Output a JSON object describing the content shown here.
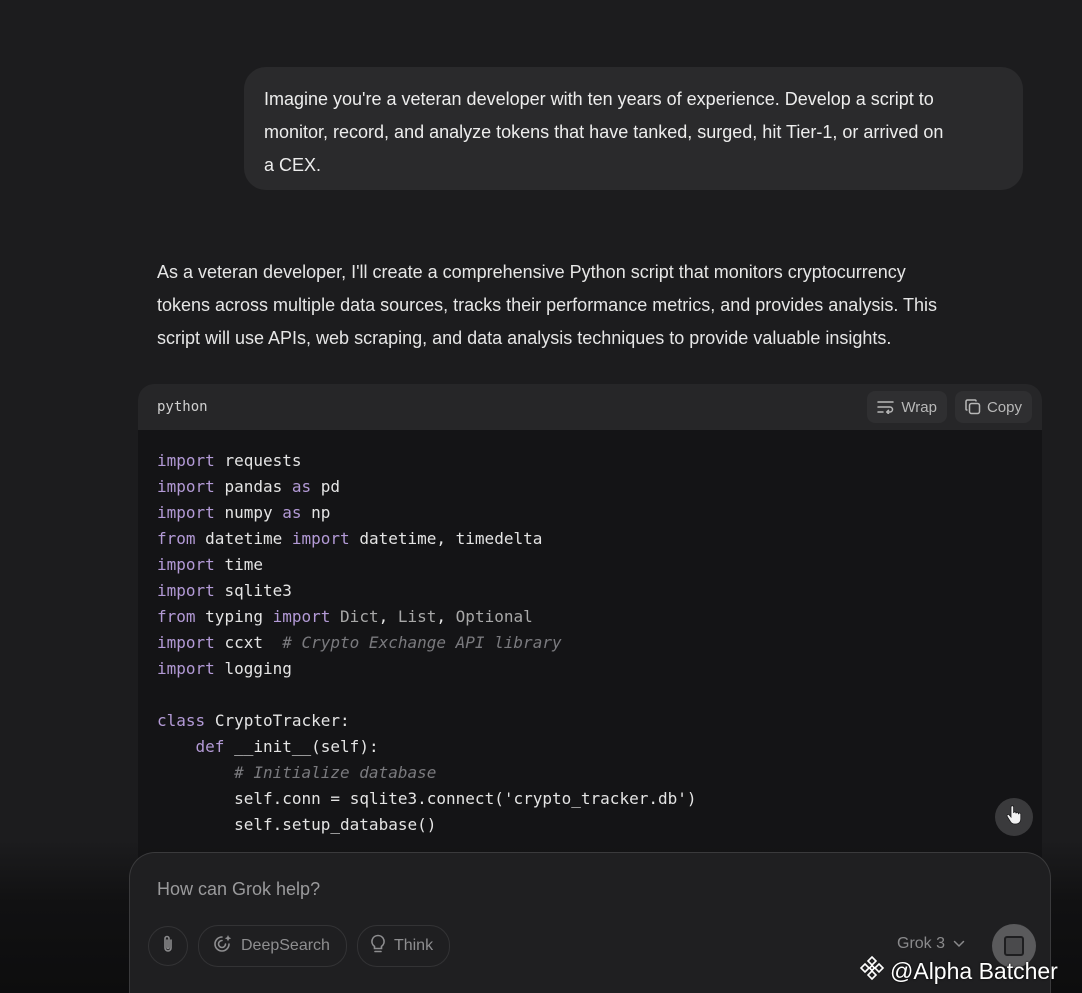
{
  "conversation": {
    "user_message": {
      "lines": [
        "Imagine you're a veteran developer with ten years of experience. Develop a script to",
        "monitor, record, and analyze tokens that have tanked, surged, hit Tier-1, or arrived on",
        "a CEX."
      ]
    },
    "assistant_intro": {
      "lines": [
        "As a veteran developer, I'll create a comprehensive Python script that monitors cryptocurrency",
        "tokens across multiple data sources, tracks their performance metrics, and provides analysis. This",
        "script will use APIs, web scraping, and data analysis techniques to provide valuable insights."
      ]
    },
    "code_block": {
      "language": "python",
      "wrap_label": "Wrap",
      "copy_label": "Copy",
      "lines": [
        "import requests",
        "import pandas as pd",
        "import numpy as np",
        "from datetime import datetime, timedelta",
        "import time",
        "import sqlite3",
        "from typing import Dict, List, Optional",
        "import ccxt  # Crypto Exchange API library",
        "import logging",
        "",
        "class CryptoTracker:",
        "    def __init__(self):",
        "        # Initialize database",
        "        self.conn = sqlite3.connect('crypto_tracker.db')",
        "        self.setup_database()"
      ]
    }
  },
  "composer": {
    "placeholder": "How can Grok help?",
    "deepsearch_label": "DeepSearch",
    "think_label": "Think",
    "model_label": "Grok 3"
  },
  "watermark": {
    "text": "@Alpha Batcher"
  },
  "colors": {
    "background": "#1c1c1e",
    "keyword": "#b39ad6",
    "comment": "#7a7a7e"
  }
}
